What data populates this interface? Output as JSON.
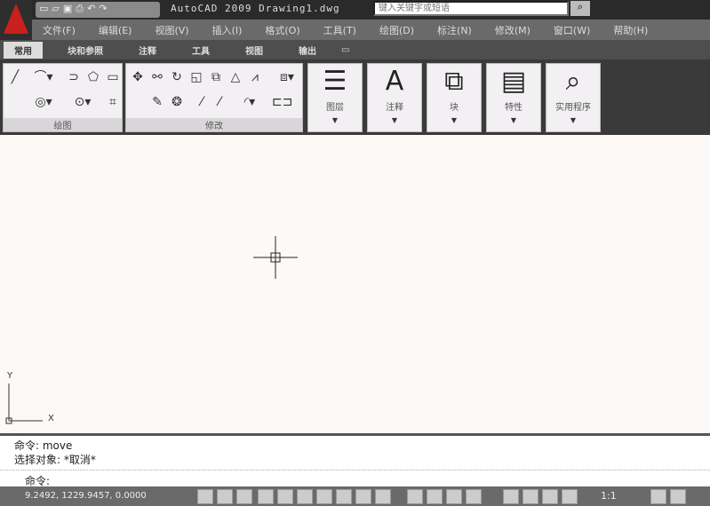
{
  "app": {
    "title": "AutoCAD 2009  Drawing1.dwg"
  },
  "search": {
    "placeholder": "键入关键字或短语"
  },
  "menu": [
    "文件(F)",
    "编辑(E)",
    "视图(V)",
    "插入(I)",
    "格式(O)",
    "工具(T)",
    "绘图(D)",
    "标注(N)",
    "修改(M)",
    "窗口(W)",
    "帮助(H)"
  ],
  "tabs": [
    "常用",
    "块和参照",
    "注释",
    "工具",
    "视图",
    "输出"
  ],
  "panels": {
    "draw": "绘图",
    "modify": "修改",
    "layers": "图层",
    "annotation": "注释",
    "block": "块",
    "properties": "特性",
    "utilities": "实用程序"
  },
  "axis": {
    "x": "X",
    "y": "Y"
  },
  "command": {
    "line1": "命令:  move",
    "line2": "选择对象: *取消*",
    "prompt": "命令:"
  },
  "status": {
    "coords": "9.2492,  1229.9457,  0.0000",
    "scale": "1:1"
  }
}
